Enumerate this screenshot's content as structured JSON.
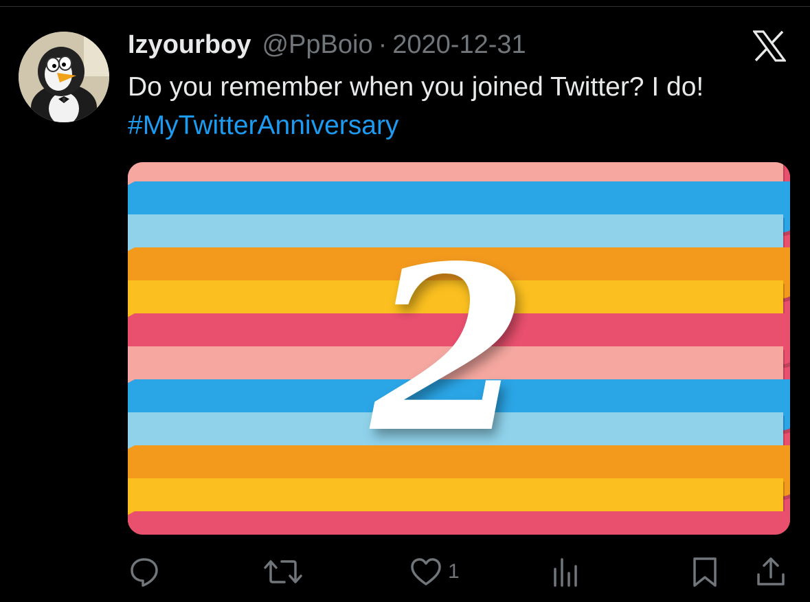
{
  "tweet": {
    "author_name": "Izyourboy",
    "handle": "@PpBoio",
    "separator": "·",
    "date": "2020-12-31",
    "text": "Do you remember when you joined Twitter? I do!",
    "hashtag": "#MyTwitterAnniversary"
  },
  "media": {
    "numeral": "2"
  },
  "actions": {
    "reply_icon": "comment-icon",
    "retweet_icon": "retweet-icon",
    "like_icon": "heart-icon",
    "like_count": "1",
    "views_icon": "bar-chart-icon",
    "bookmark_icon": "bookmark-icon",
    "share_icon": "share-icon"
  },
  "colors": {
    "background": "#000000",
    "primary_text": "#e7e9ea",
    "secondary_text": "#71767b",
    "link": "#1d9bf0",
    "blue_band": "#2aa5e6",
    "light_blue_band": "#8fd2ea",
    "orange_band": "#f39a1d",
    "yellow_band": "#fbbf1f",
    "red_band": "#e9506e",
    "pink_band": "#f5a7a0"
  }
}
